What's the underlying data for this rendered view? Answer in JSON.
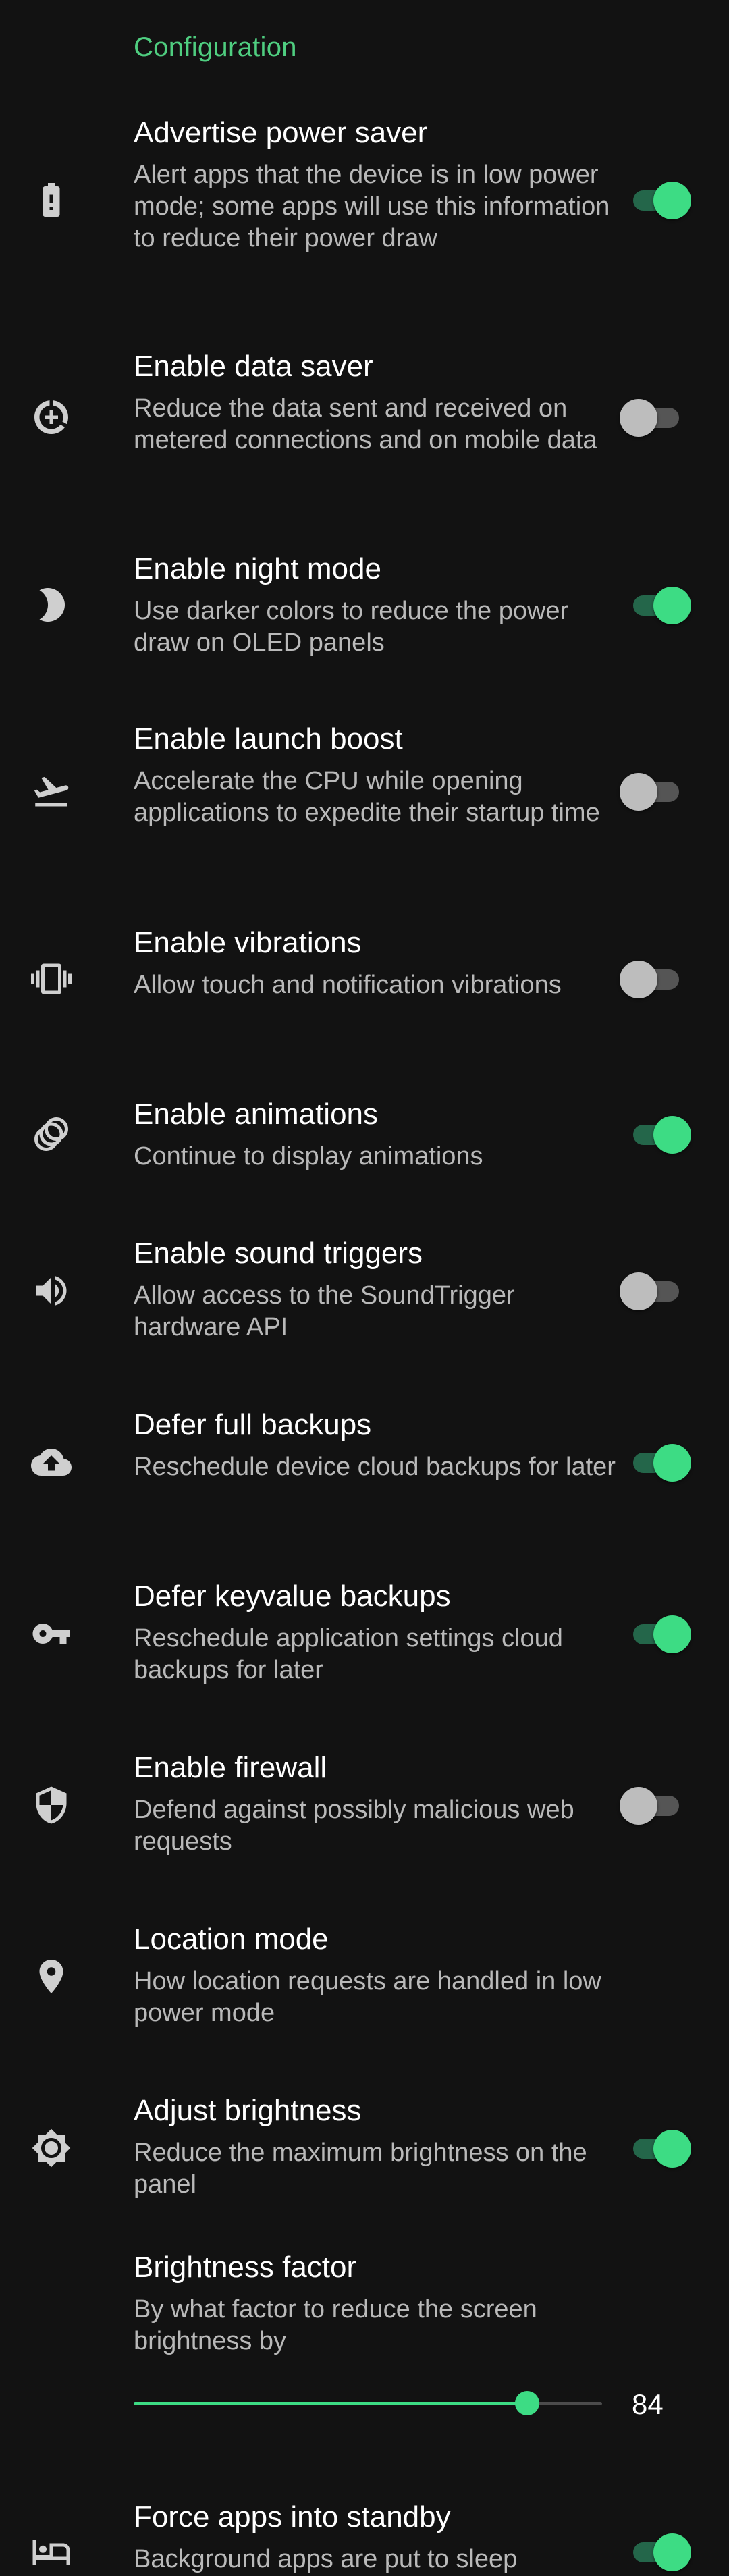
{
  "section_header": "Configuration",
  "colors": {
    "accent": "#3ddc84",
    "accent_track": "#24664a",
    "background": "#121212"
  },
  "preferences": [
    {
      "icon": "battery-alert-icon",
      "title": "Advertise power saver",
      "summary": "Alert apps that the device is in low power mode; some apps will use this information to reduce their power draw",
      "enabled": true
    },
    {
      "icon": "data-saver-icon",
      "title": "Enable data saver",
      "summary": "Reduce the data sent and received on metered connections and on mobile data",
      "enabled": false
    },
    {
      "icon": "moon-icon",
      "title": "Enable night mode",
      "summary": "Use darker colors to reduce the power draw on OLED panels",
      "enabled": true
    },
    {
      "icon": "airplane-takeoff-icon",
      "title": "Enable launch boost",
      "summary": "Accelerate the CPU while opening applications to expedite their startup time",
      "enabled": false
    },
    {
      "icon": "vibration-icon",
      "title": "Enable vibrations",
      "summary": "Allow touch and notification vibrations",
      "enabled": false
    },
    {
      "icon": "animation-icon",
      "title": "Enable animations",
      "summary": "Continue to display animations",
      "enabled": true
    },
    {
      "icon": "speaker-icon",
      "title": "Enable sound triggers",
      "summary": "Allow access to the SoundTrigger hardware API",
      "enabled": false
    },
    {
      "icon": "cloud-upload-icon",
      "title": "Defer full backups",
      "summary": "Reschedule device cloud backups for later",
      "enabled": true
    },
    {
      "icon": "key-icon",
      "title": "Defer keyvalue backups",
      "summary": "Reschedule application settings cloud backups for later",
      "enabled": true
    },
    {
      "icon": "shield-icon",
      "title": "Enable firewall",
      "summary": "Defend against possibly malicious web requests",
      "enabled": false
    },
    {
      "icon": "location-pin-icon",
      "title": "Location mode",
      "summary": "How location requests are handled in low power mode"
    },
    {
      "icon": "brightness-icon",
      "title": "Adjust brightness",
      "summary": "Reduce the maximum brightness on the panel",
      "enabled": true
    },
    {
      "title": "Brightness factor",
      "summary": "By what factor to reduce the screen brightness by",
      "slider_value": "84",
      "slider_fraction": 0.84
    },
    {
      "icon": "standby-icon",
      "title": "Force apps into standby",
      "summary": "Background apps are put to sleep",
      "enabled": true
    }
  ]
}
